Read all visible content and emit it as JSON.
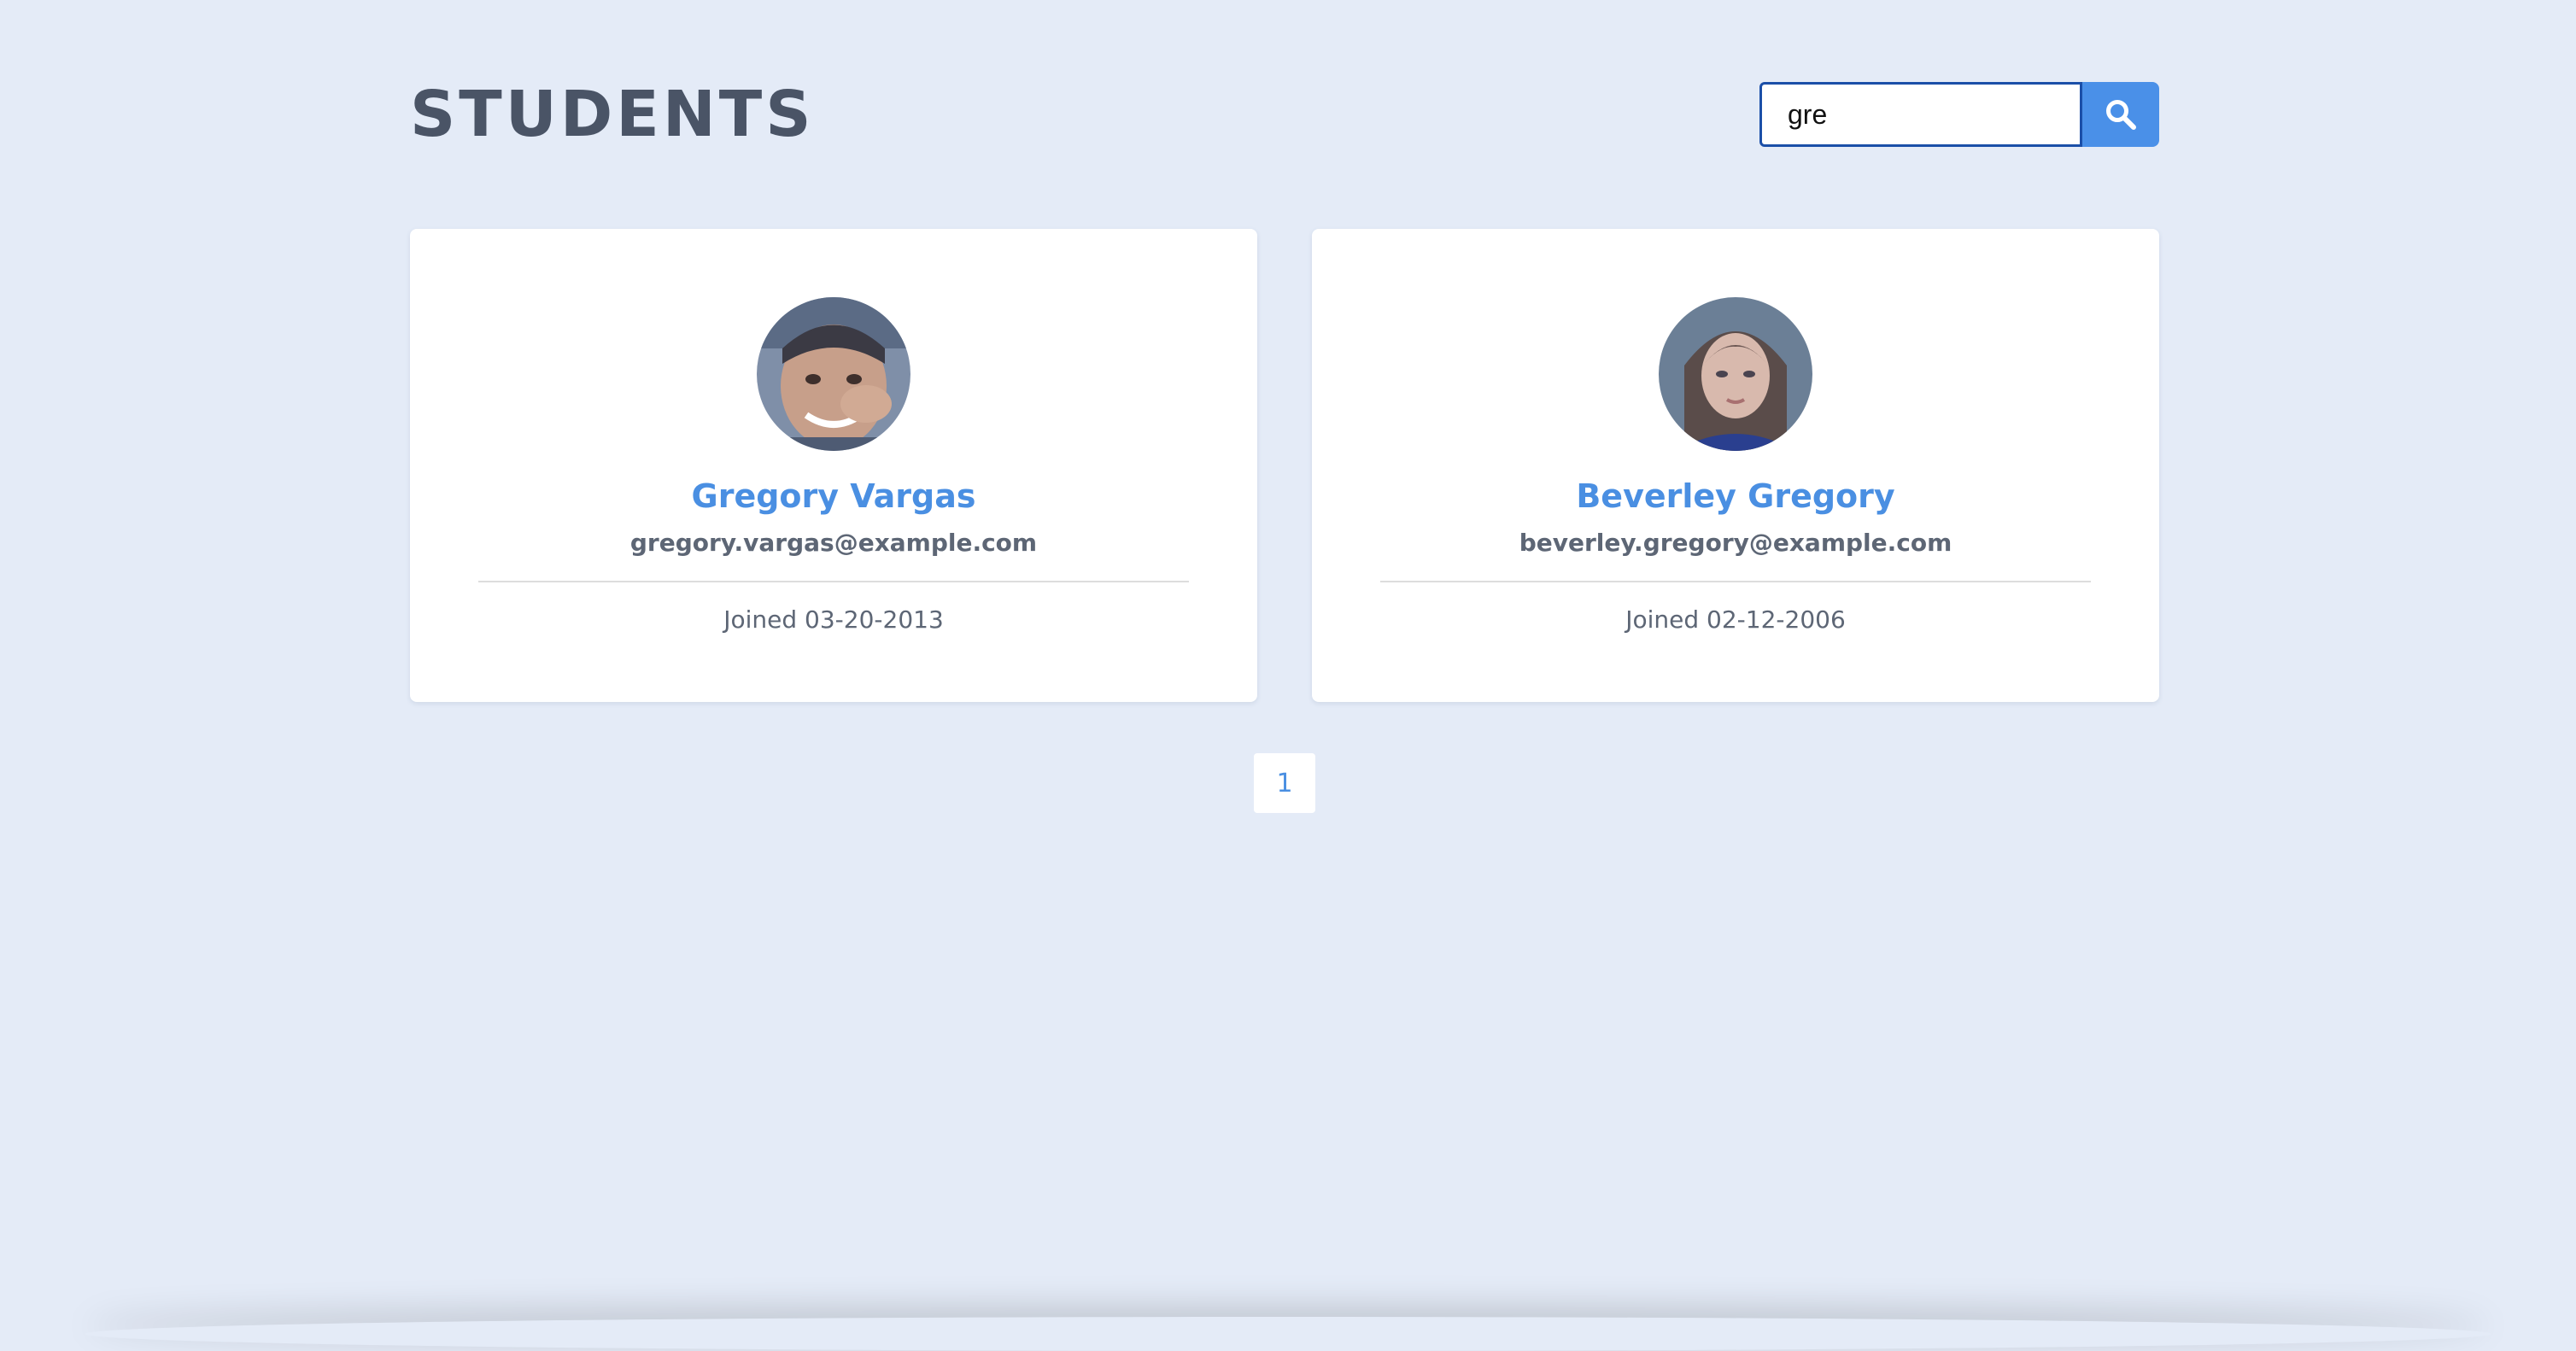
{
  "page": {
    "title": "STUDENTS"
  },
  "search": {
    "value": "gre",
    "icon": "search-icon"
  },
  "students": [
    {
      "name": "Gregory Vargas",
      "email": "gregory.vargas@example.com",
      "joined": "Joined 03-20-2013"
    },
    {
      "name": "Beverley Gregory",
      "email": "beverley.gregory@example.com",
      "joined": "Joined 02-12-2006"
    }
  ],
  "pagination": {
    "pages": [
      "1"
    ]
  },
  "colors": {
    "background": "#e4ebf7",
    "accent": "#4a8fe2",
    "title": "#4a5466"
  }
}
